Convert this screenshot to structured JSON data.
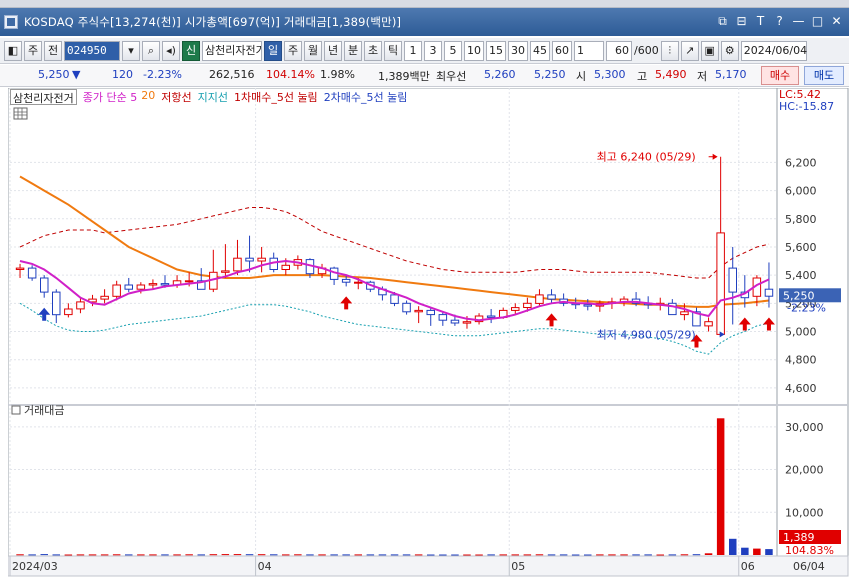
{
  "window": {
    "title": "KOSDAQ 주식수[13,274(천)] 시가총액[697(억)] 거래대금[1,389(백만)]",
    "controls": [
      "⧉",
      "⊟",
      "T",
      "?",
      "—",
      "□",
      "✕"
    ]
  },
  "toolbar": {
    "stock_type": "주",
    "all_label": "전",
    "code": "024950",
    "new_badge": "신",
    "stock_name": "삼천리자전거",
    "periods": [
      "일",
      "주",
      "월",
      "년",
      "분",
      "초",
      "틱"
    ],
    "active_period": "일",
    "intervals": [
      "1",
      "3",
      "5",
      "10",
      "15",
      "30",
      "45",
      "60"
    ],
    "unit_value": "1",
    "count": "60",
    "count_total": "/600",
    "date": "2024/06/04"
  },
  "quote": {
    "price": "5,250",
    "arrow": "▼",
    "change": "120",
    "change_pct": "-2.23%",
    "volume": "262,516",
    "vol_ratio": "104.14%",
    "turnover": "1.98%",
    "amount": "1,389백만",
    "best_label": "최우선",
    "best_ask": "5,260",
    "best_bid": "5,250",
    "open_label": "시",
    "open": "5,300",
    "high_label": "고",
    "high": "5,490",
    "low_label": "저",
    "low": "5,170",
    "buy_label": "매수",
    "sell_label": "매도"
  },
  "legend": {
    "name": "삼천리자전거",
    "ma_label": "종가 단순 5",
    "ma20": "20",
    "resistance": "저항선",
    "support": "지지선",
    "buy1": "1차매수_5선 눌림",
    "buy2": "2차매수_5선 눌림",
    "lc": "LC:5.42",
    "hc": "HC:-15.87"
  },
  "colors": {
    "up": "#e00000",
    "down": "#1f3fbf",
    "ma5": "#d020c8",
    "ma20": "#f07a10",
    "resistance": "#c00000",
    "support": "#17a0b0"
  },
  "chart_data": [
    {
      "type": "candlestick",
      "title": "",
      "x": [
        "2024/03/04",
        "2024/03/05",
        "2024/03/06",
        "2024/03/07",
        "2024/03/08",
        "2024/03/11",
        "2024/03/12",
        "2024/03/13",
        "2024/03/14",
        "2024/03/15",
        "2024/03/18",
        "2024/03/19",
        "2024/03/20",
        "2024/03/21",
        "2024/03/22",
        "2024/03/25",
        "2024/03/26",
        "2024/03/27",
        "2024/03/28",
        "2024/03/29",
        "2024/04/01",
        "2024/04/02",
        "2024/04/03",
        "2024/04/04",
        "2024/04/05",
        "2024/04/08",
        "2024/04/09",
        "2024/04/11",
        "2024/04/12",
        "2024/04/15",
        "2024/04/16",
        "2024/04/17",
        "2024/04/18",
        "2024/04/19",
        "2024/04/22",
        "2024/04/23",
        "2024/04/24",
        "2024/04/25",
        "2024/04/26",
        "2024/04/29",
        "2024/04/30",
        "2024/05/02",
        "2024/05/03",
        "2024/05/07",
        "2024/05/08",
        "2024/05/09",
        "2024/05/10",
        "2024/05/13",
        "2024/05/14",
        "2024/05/16",
        "2024/05/17",
        "2024/05/20",
        "2024/05/21",
        "2024/05/22",
        "2024/05/23",
        "2024/05/24",
        "2024/05/27",
        "2024/05/28",
        "2024/05/29",
        "2024/05/30",
        "2024/05/31",
        "2024/06/03",
        "2024/06/04"
      ],
      "open": [
        5440,
        5450,
        5380,
        5280,
        5120,
        5160,
        5210,
        5230,
        5250,
        5330,
        5300,
        5330,
        5340,
        5330,
        5360,
        5360,
        5300,
        5420,
        5430,
        5520,
        5500,
        5520,
        5440,
        5470,
        5510,
        5410,
        5450,
        5370,
        5350,
        5350,
        5300,
        5260,
        5200,
        5140,
        5150,
        5120,
        5080,
        5060,
        5070,
        5110,
        5100,
        5150,
        5170,
        5200,
        5260,
        5230,
        5200,
        5190,
        5180,
        5200,
        5210,
        5230,
        5200,
        5190,
        5200,
        5120,
        5140,
        5040,
        4980,
        5450,
        5280,
        5250,
        5300
      ],
      "high": [
        5480,
        5470,
        5400,
        5300,
        5200,
        5240,
        5260,
        5300,
        5360,
        5380,
        5350,
        5370,
        5400,
        5400,
        5420,
        5450,
        5580,
        5620,
        5650,
        5680,
        5600,
        5560,
        5520,
        5540,
        5520,
        5480,
        5460,
        5400,
        5380,
        5360,
        5320,
        5280,
        5220,
        5180,
        5170,
        5140,
        5120,
        5110,
        5130,
        5160,
        5170,
        5200,
        5240,
        5300,
        5300,
        5270,
        5240,
        5230,
        5220,
        5240,
        5250,
        5280,
        5250,
        5240,
        5230,
        5200,
        5170,
        5100,
        6240,
        5600,
        5400,
        5400,
        5490
      ],
      "low": [
        5380,
        5360,
        5240,
        5060,
        5100,
        5130,
        5180,
        5200,
        5220,
        5280,
        5270,
        5300,
        5310,
        5310,
        5320,
        5300,
        5280,
        5380,
        5400,
        5420,
        5420,
        5420,
        5400,
        5440,
        5380,
        5380,
        5330,
        5320,
        5300,
        5280,
        5220,
        5180,
        5120,
        5060,
        5040,
        5040,
        5040,
        5020,
        5050,
        5060,
        5090,
        5120,
        5140,
        5180,
        5200,
        5180,
        5160,
        5150,
        5140,
        5160,
        5180,
        5180,
        5160,
        5150,
        5140,
        5080,
        5050,
        5000,
        4980,
        5050,
        5170,
        5180,
        5170
      ],
      "close": [
        5450,
        5380,
        5280,
        5120,
        5160,
        5210,
        5230,
        5250,
        5330,
        5300,
        5330,
        5340,
        5330,
        5360,
        5360,
        5300,
        5420,
        5430,
        5520,
        5500,
        5520,
        5440,
        5470,
        5510,
        5410,
        5450,
        5370,
        5350,
        5350,
        5300,
        5260,
        5200,
        5140,
        5150,
        5120,
        5080,
        5060,
        5070,
        5110,
        5100,
        5150,
        5170,
        5200,
        5260,
        5230,
        5200,
        5190,
        5180,
        5200,
        5210,
        5230,
        5200,
        5190,
        5200,
        5120,
        5140,
        5040,
        5070,
        5700,
        5280,
        5240,
        5380,
        5250
      ],
      "ma5": [
        5500,
        5480,
        5440,
        5380,
        5310,
        5240,
        5200,
        5190,
        5230,
        5270,
        5290,
        5300,
        5320,
        5330,
        5340,
        5350,
        5370,
        5390,
        5420,
        5440,
        5470,
        5490,
        5500,
        5490,
        5470,
        5450,
        5420,
        5400,
        5370,
        5330,
        5300,
        5270,
        5240,
        5200,
        5170,
        5140,
        5110,
        5090,
        5080,
        5090,
        5100,
        5120,
        5150,
        5180,
        5200,
        5210,
        5200,
        5200,
        5190,
        5200,
        5210,
        5210,
        5200,
        5190,
        5180,
        5160,
        5130,
        5110,
        5220,
        5240,
        5270,
        5330,
        5370
      ],
      "ma20": [
        6100,
        6050,
        6000,
        5950,
        5900,
        5840,
        5780,
        5720,
        5660,
        5600,
        5560,
        5520,
        5480,
        5440,
        5420,
        5400,
        5390,
        5380,
        5380,
        5380,
        5390,
        5400,
        5400,
        5400,
        5400,
        5400,
        5395,
        5390,
        5385,
        5380,
        5370,
        5360,
        5350,
        5340,
        5330,
        5320,
        5310,
        5300,
        5290,
        5280,
        5270,
        5260,
        5250,
        5240,
        5230,
        5225,
        5220,
        5215,
        5210,
        5205,
        5200,
        5195,
        5190,
        5190,
        5185,
        5180,
        5175,
        5175,
        5190,
        5195,
        5200,
        5210,
        5220
      ],
      "resistance": [
        5600,
        5640,
        5680,
        5700,
        5720,
        5720,
        5720,
        5700,
        5710,
        5720,
        5730,
        5740,
        5750,
        5760,
        5780,
        5800,
        5820,
        5840,
        5860,
        5880,
        5880,
        5870,
        5850,
        5810,
        5760,
        5710,
        5680,
        5650,
        5620,
        5590,
        5560,
        5530,
        5500,
        5480,
        5460,
        5440,
        5430,
        5420,
        5420,
        5420,
        5420,
        5420,
        5430,
        5440,
        5440,
        5440,
        5430,
        5420,
        5420,
        5420,
        5420,
        5420,
        5420,
        5410,
        5400,
        5390,
        5380,
        5380,
        5460,
        5520,
        5560,
        5600,
        5620
      ],
      "support": [
        5200,
        5150,
        5090,
        5040,
        5010,
        5000,
        5000,
        5010,
        5030,
        5050,
        5060,
        5070,
        5080,
        5090,
        5100,
        5110,
        5130,
        5150,
        5170,
        5190,
        5190,
        5190,
        5180,
        5160,
        5140,
        5110,
        5090,
        5070,
        5050,
        5040,
        5030,
        5020,
        5010,
        5000,
        4990,
        4980,
        4970,
        4970,
        4970,
        4980,
        4990,
        5000,
        5010,
        5020,
        5020,
        5010,
        5000,
        4990,
        4980,
        4980,
        4980,
        4970,
        4960,
        4950,
        4930,
        4900,
        4860,
        4840,
        4920,
        4970,
        5000,
        5040,
        5060
      ],
      "amount": [
        160,
        150,
        200,
        150,
        120,
        130,
        130,
        140,
        160,
        150,
        130,
        130,
        140,
        150,
        160,
        150,
        180,
        200,
        220,
        190,
        180,
        170,
        150,
        160,
        150,
        140,
        140,
        130,
        140,
        140,
        130,
        130,
        150,
        140,
        120,
        110,
        110,
        110,
        120,
        130,
        130,
        140,
        150,
        170,
        150,
        130,
        120,
        120,
        130,
        130,
        140,
        130,
        130,
        120,
        140,
        160,
        180,
        400,
        32000,
        3800,
        1700,
        1500,
        1389
      ],
      "buy_signals": [
        "2024/03/06",
        "2024/04/11",
        "2024/05/08",
        "2024/05/27",
        "2024/05/31",
        "2024/06/04"
      ],
      "ylim": [
        4500,
        6600
      ],
      "yticks": [
        "4,600",
        "4,800",
        "5,000",
        "5,200",
        "5,400",
        "5,600",
        "5,800",
        "6,000",
        "6,200"
      ],
      "vol_ylim": [
        0,
        33000
      ],
      "vol_yticks": [
        "10,000",
        "20,000",
        "30,000"
      ],
      "xlabels": [
        "2024/03",
        "04",
        "05",
        "06"
      ],
      "xlabel_right": "06/04",
      "max_annotation": "최고 6,240 (05/29)",
      "min_annotation": "최저 4,980 (05/29)",
      "last_price_tag": "5,250",
      "last_pct_tag": "-2.23%",
      "volume_panel_label": "거래대금",
      "last_amount_tag": "1,389",
      "last_amount_pct": "104.83%"
    }
  ]
}
